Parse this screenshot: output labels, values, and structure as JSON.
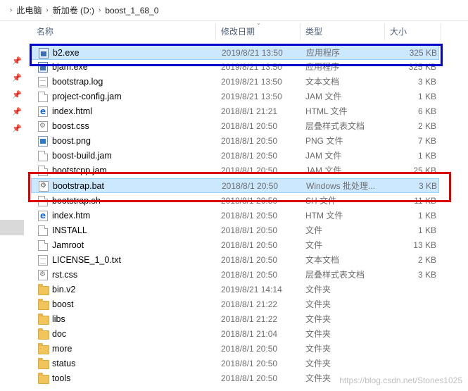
{
  "breadcrumb": [
    "此电脑",
    "新加卷 (D:)",
    "boost_1_68_0"
  ],
  "columns": {
    "name": "名称",
    "date": "修改日期",
    "type": "类型",
    "size": "大小"
  },
  "files": [
    {
      "name": "b2.exe",
      "date": "2019/8/21 13:50",
      "type": "应用程序",
      "size": "325 KB",
      "icon": "exe-icon",
      "selected": true
    },
    {
      "name": "bjam.exe",
      "date": "2019/8/21 13:50",
      "type": "应用程序",
      "size": "325 KB",
      "icon": "exe-icon",
      "selected": false
    },
    {
      "name": "bootstrap.log",
      "date": "2019/8/21 13:50",
      "type": "文本文档",
      "size": "3 KB",
      "icon": "text-file-icon",
      "selected": false
    },
    {
      "name": "project-config.jam",
      "date": "2019/8/21 13:50",
      "type": "JAM 文件",
      "size": "1 KB",
      "icon": "file-icon",
      "selected": false
    },
    {
      "name": "index.html",
      "date": "2018/8/1 21:21",
      "type": "HTML 文件",
      "size": "6 KB",
      "icon": "html-file-icon",
      "selected": false
    },
    {
      "name": "boost.css",
      "date": "2018/8/1 20:50",
      "type": "层叠样式表文档",
      "size": "2 KB",
      "icon": "css-file-icon",
      "selected": false
    },
    {
      "name": "boost.png",
      "date": "2018/8/1 20:50",
      "type": "PNG 文件",
      "size": "7 KB",
      "icon": "image-file-icon",
      "selected": false
    },
    {
      "name": "boost-build.jam",
      "date": "2018/8/1 20:50",
      "type": "JAM 文件",
      "size": "1 KB",
      "icon": "file-icon",
      "selected": false
    },
    {
      "name": "bootstcpp.jam",
      "date": "2018/8/1 20:50",
      "type": "JAM 文件",
      "size": "25 KB",
      "icon": "file-icon",
      "selected": false
    },
    {
      "name": "bootstrap.bat",
      "date": "2018/8/1 20:50",
      "type": "Windows 批处理...",
      "size": "3 KB",
      "icon": "batch-file-icon",
      "selected": true
    },
    {
      "name": "bootstrap.sh",
      "date": "2018/8/1 20:50",
      "type": "SH 文件",
      "size": "11 KB",
      "icon": "file-icon",
      "selected": false
    },
    {
      "name": "index.htm",
      "date": "2018/8/1 20:50",
      "type": "HTM 文件",
      "size": "1 KB",
      "icon": "html-file-icon",
      "selected": false
    },
    {
      "name": "INSTALL",
      "date": "2018/8/1 20:50",
      "type": "文件",
      "size": "1 KB",
      "icon": "file-icon",
      "selected": false
    },
    {
      "name": "Jamroot",
      "date": "2018/8/1 20:50",
      "type": "文件",
      "size": "13 KB",
      "icon": "file-icon",
      "selected": false
    },
    {
      "name": "LICENSE_1_0.txt",
      "date": "2018/8/1 20:50",
      "type": "文本文档",
      "size": "2 KB",
      "icon": "text-file-icon",
      "selected": false
    },
    {
      "name": "rst.css",
      "date": "2018/8/1 20:50",
      "type": "层叠样式表文档",
      "size": "3 KB",
      "icon": "css-file-icon",
      "selected": false
    },
    {
      "name": "bin.v2",
      "date": "2019/8/21 14:14",
      "type": "文件夹",
      "size": "",
      "icon": "folder-icon",
      "selected": false
    },
    {
      "name": "boost",
      "date": "2018/8/1 21:22",
      "type": "文件夹",
      "size": "",
      "icon": "folder-icon",
      "selected": false
    },
    {
      "name": "libs",
      "date": "2018/8/1 21:22",
      "type": "文件夹",
      "size": "",
      "icon": "folder-icon",
      "selected": false
    },
    {
      "name": "doc",
      "date": "2018/8/1 21:04",
      "type": "文件夹",
      "size": "",
      "icon": "folder-icon",
      "selected": false
    },
    {
      "name": "more",
      "date": "2018/8/1 20:50",
      "type": "文件夹",
      "size": "",
      "icon": "folder-icon",
      "selected": false
    },
    {
      "name": "status",
      "date": "2018/8/1 20:50",
      "type": "文件夹",
      "size": "",
      "icon": "folder-icon",
      "selected": false
    },
    {
      "name": "tools",
      "date": "2018/8/1 20:50",
      "type": "文件夹",
      "size": "",
      "icon": "folder-icon",
      "selected": false
    }
  ],
  "watermark": "https://blog.csdn.net/Stones1025",
  "colors": {
    "selection": "#cce8ff",
    "annotation_blue": "#0000cc",
    "annotation_red": "#dd0000"
  }
}
